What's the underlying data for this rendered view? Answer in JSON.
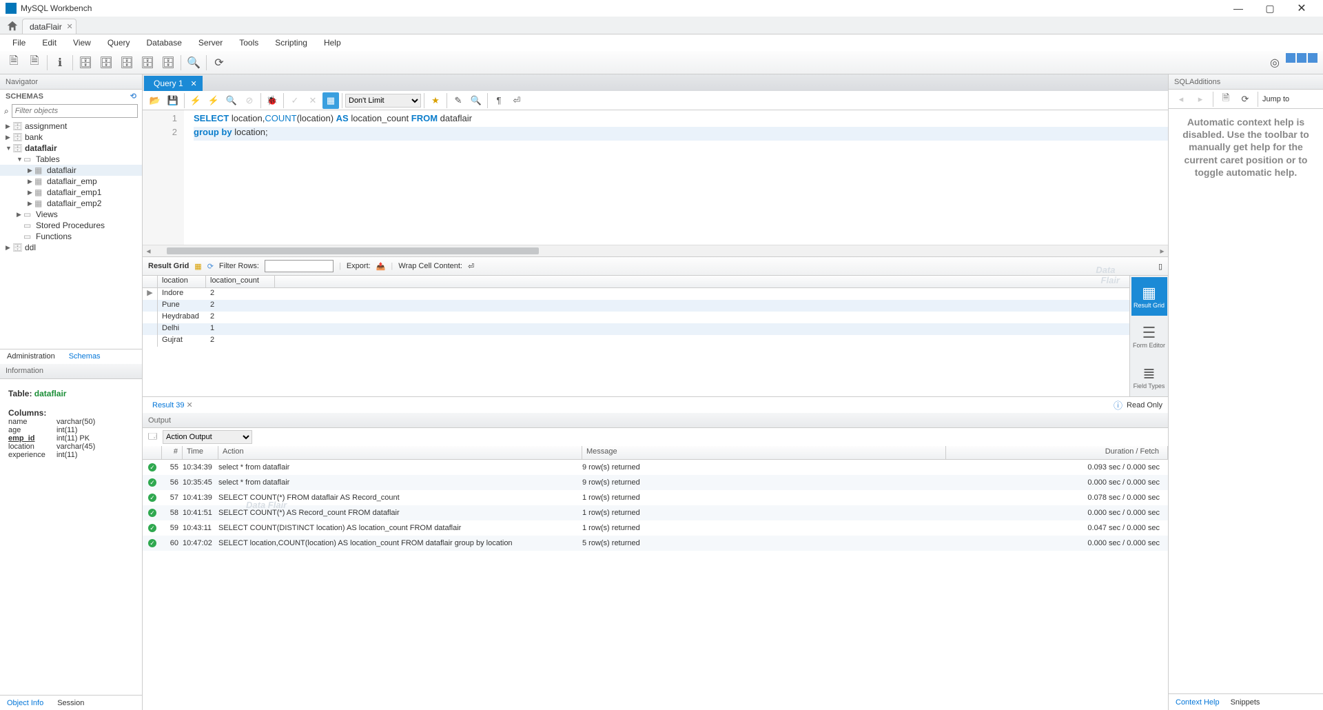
{
  "app": {
    "title": "MySQL Workbench"
  },
  "connection_tab": "dataFlair",
  "menu": [
    "File",
    "Edit",
    "View",
    "Query",
    "Database",
    "Server",
    "Tools",
    "Scripting",
    "Help"
  ],
  "navigator": {
    "title": "Navigator",
    "schemas_label": "SCHEMAS",
    "filter_placeholder": "Filter objects",
    "tree": [
      {
        "label": "assignment",
        "icon": "db",
        "indent": 0,
        "arrow": "▶"
      },
      {
        "label": "bank",
        "icon": "db",
        "indent": 0,
        "arrow": "▶"
      },
      {
        "label": "dataflair",
        "icon": "db",
        "indent": 0,
        "arrow": "▼",
        "bold": true
      },
      {
        "label": "Tables",
        "icon": "folder",
        "indent": 1,
        "arrow": "▼"
      },
      {
        "label": "dataflair",
        "icon": "table",
        "indent": 2,
        "arrow": "▶",
        "selected": true
      },
      {
        "label": "dataflair_emp",
        "icon": "table",
        "indent": 2,
        "arrow": "▶"
      },
      {
        "label": "dataflair_emp1",
        "icon": "table",
        "indent": 2,
        "arrow": "▶"
      },
      {
        "label": "dataflair_emp2",
        "icon": "table",
        "indent": 2,
        "arrow": "▶"
      },
      {
        "label": "Views",
        "icon": "folder",
        "indent": 1,
        "arrow": "▶"
      },
      {
        "label": "Stored Procedures",
        "icon": "folder",
        "indent": 1,
        "arrow": ""
      },
      {
        "label": "Functions",
        "icon": "folder",
        "indent": 1,
        "arrow": ""
      },
      {
        "label": "ddl",
        "icon": "db",
        "indent": 0,
        "arrow": "▶"
      }
    ],
    "tabs": {
      "admin": "Administration",
      "schemas": "Schemas"
    }
  },
  "information": {
    "title": "Information",
    "table_label": "Table:",
    "table_name": "dataflair",
    "columns_label": "Columns:",
    "columns": [
      {
        "name": "name",
        "type": "varchar(50)"
      },
      {
        "name": "age",
        "type": "int(11)"
      },
      {
        "name": "emp_id",
        "type": "int(11) PK",
        "pk": true
      },
      {
        "name": "location",
        "type": "varchar(45)"
      },
      {
        "name": "experience",
        "type": "int(11)"
      }
    ],
    "tabs": {
      "object": "Object Info",
      "session": "Session"
    }
  },
  "query": {
    "tab_label": "Query 1",
    "limit": "Don't Limit",
    "lines": [
      {
        "n": "1",
        "parts": [
          {
            "t": "SELECT",
            "c": "kw"
          },
          {
            "t": " location,"
          },
          {
            "t": "COUNT",
            "c": "fn"
          },
          {
            "t": "(location) "
          },
          {
            "t": "AS",
            "c": "kw"
          },
          {
            "t": " location_count "
          },
          {
            "t": "FROM",
            "c": "kw"
          },
          {
            "t": " dataflair"
          }
        ]
      },
      {
        "n": "2",
        "active": true,
        "parts": [
          {
            "t": "group by",
            "c": "kw"
          },
          {
            "t": " location;"
          }
        ]
      }
    ]
  },
  "result": {
    "toolbar": {
      "label": "Result Grid",
      "filter_label": "Filter Rows:",
      "export_label": "Export:",
      "wrap_label": "Wrap Cell Content:"
    },
    "headers": [
      "location",
      "location_count"
    ],
    "rows": [
      {
        "location": "Indore",
        "count": "2"
      },
      {
        "location": "Pune",
        "count": "2"
      },
      {
        "location": "Heydrabad",
        "count": "2"
      },
      {
        "location": "Delhi",
        "count": "1"
      },
      {
        "location": "Gujrat",
        "count": "2"
      }
    ],
    "side": [
      {
        "label": "Result Grid"
      },
      {
        "label": "Form Editor"
      },
      {
        "label": "Field Types"
      }
    ],
    "tab_label": "Result 39",
    "readonly": "Read Only"
  },
  "output": {
    "title": "Output",
    "select": "Action Output",
    "headers": {
      "num": "#",
      "time": "Time",
      "action": "Action",
      "message": "Message",
      "dur": "Duration / Fetch"
    },
    "rows": [
      {
        "n": "55",
        "time": "10:34:39",
        "action": "select * from dataflair",
        "msg": "9 row(s) returned",
        "dur": "0.093 sec / 0.000 sec"
      },
      {
        "n": "56",
        "time": "10:35:45",
        "action": "select * from dataflair",
        "msg": "9 row(s) returned",
        "dur": "0.000 sec / 0.000 sec"
      },
      {
        "n": "57",
        "time": "10:41:39",
        "action": "SELECT COUNT(*) FROM dataflair AS Record_count",
        "msg": "1 row(s) returned",
        "dur": "0.078 sec / 0.000 sec"
      },
      {
        "n": "58",
        "time": "10:41:51",
        "action": "SELECT COUNT(*) AS Record_count FROM dataflair",
        "msg": "1 row(s) returned",
        "dur": "0.000 sec / 0.000 sec"
      },
      {
        "n": "59",
        "time": "10:43:11",
        "action": "SELECT COUNT(DISTINCT location) AS location_count FROM dataflair",
        "msg": "1 row(s) returned",
        "dur": "0.047 sec / 0.000 sec"
      },
      {
        "n": "60",
        "time": "10:47:02",
        "action": "SELECT location,COUNT(location) AS location_count FROM dataflair  group by location",
        "msg": "5 row(s) returned",
        "dur": "0.000 sec / 0.000 sec"
      }
    ]
  },
  "sql_additions": {
    "title": "SQLAdditions",
    "jump": "Jump to",
    "help_text": "Automatic context help is disabled. Use the toolbar to manually get help for the current caret position or to toggle automatic help.",
    "tabs": {
      "context": "Context Help",
      "snippets": "Snippets"
    }
  }
}
